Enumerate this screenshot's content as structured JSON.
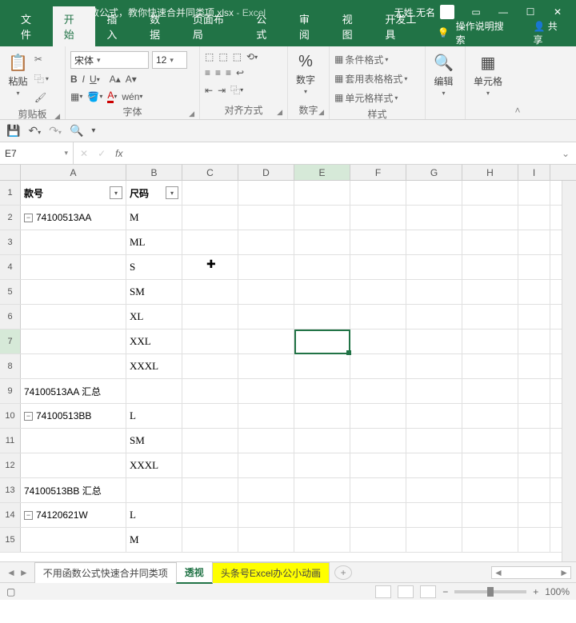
{
  "title": {
    "filename": "不用函数公式，教你快速合并同类项.xlsx",
    "app": "Excel",
    "user": "无姓 无名"
  },
  "tabs": {
    "file": "文件",
    "home": "开始",
    "insert": "插入",
    "data": "数据",
    "layout": "页面布局",
    "formulas": "公式",
    "review": "审阅",
    "view": "视图",
    "dev": "开发工具",
    "tell": "操作说明搜索",
    "share": "共享"
  },
  "ribbon": {
    "clipboard": {
      "label": "剪贴板",
      "paste": "粘贴"
    },
    "font": {
      "label": "字体",
      "name": "宋体",
      "size": "12"
    },
    "align": {
      "label": "对齐方式"
    },
    "number": {
      "label": "数字",
      "btn": "数字"
    },
    "styles": {
      "label": "样式",
      "cond": "条件格式",
      "table": "套用表格格式",
      "cell": "单元格样式"
    },
    "editing": {
      "label": "编辑",
      "btn": "编辑"
    },
    "cells": {
      "label": "单元格",
      "btn": "单元格"
    }
  },
  "namebox": "E7",
  "columns": [
    "A",
    "B",
    "C",
    "D",
    "E",
    "F",
    "G",
    "H",
    "I"
  ],
  "headers": {
    "a": "款号",
    "b": "尺码"
  },
  "rows": [
    {
      "n": 1,
      "a": "款号",
      "b": "尺码",
      "hdr": true
    },
    {
      "n": 2,
      "a": "74100513AA",
      "b": "M",
      "c": "-"
    },
    {
      "n": 3,
      "a": "",
      "b": "ML"
    },
    {
      "n": 4,
      "a": "",
      "b": "S"
    },
    {
      "n": 5,
      "a": "",
      "b": "SM"
    },
    {
      "n": 6,
      "a": "",
      "b": "XL"
    },
    {
      "n": 7,
      "a": "",
      "b": "XXL"
    },
    {
      "n": 8,
      "a": "",
      "b": "XXXL"
    },
    {
      "n": 9,
      "a": "74100513AA 汇总",
      "b": ""
    },
    {
      "n": 10,
      "a": "74100513BB",
      "b": "L",
      "c": "-"
    },
    {
      "n": 11,
      "a": "",
      "b": "SM"
    },
    {
      "n": 12,
      "a": "",
      "b": "XXXL"
    },
    {
      "n": 13,
      "a": "74100513BB 汇总",
      "b": ""
    },
    {
      "n": 14,
      "a": "74120621W",
      "b": "L",
      "c": "-"
    },
    {
      "n": 15,
      "a": "",
      "b": "M"
    }
  ],
  "sheettabs": {
    "s1": "不用函数公式快速合并同类项",
    "s2": "透视",
    "s3": "头条号Excel办公小动画"
  },
  "zoom": "100%"
}
